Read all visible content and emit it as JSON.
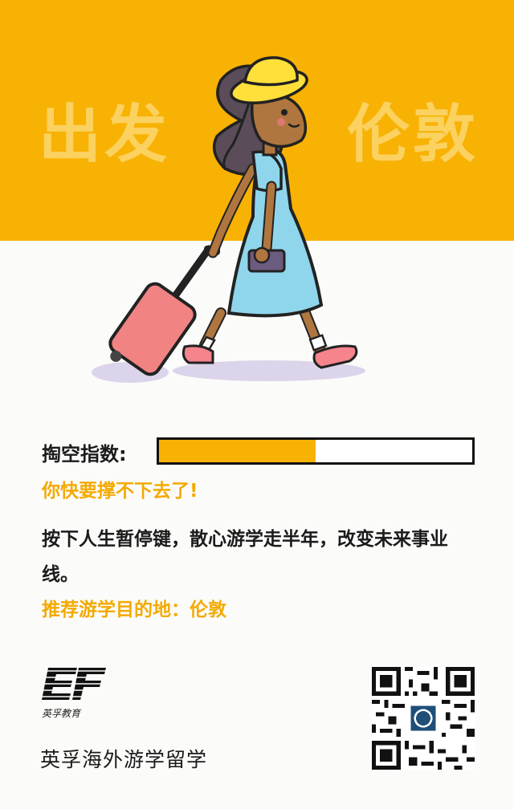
{
  "colors": {
    "accent": "#f8b204",
    "text": "#1b1b1b",
    "warning_text": "#f4aa02"
  },
  "header": {
    "word_left": "出发",
    "word_right": "伦敦"
  },
  "meter": {
    "label": "掏空指数:",
    "level_percent": 50
  },
  "warning": "你快要撑不下去了!",
  "body": "按下人生暂停键，散心游学走半年，改变未来事业线。",
  "destination": "推荐游学目的地：伦敦",
  "logo": {
    "sub": "英孚教育",
    "mark": "EF"
  },
  "footer": {
    "brand": "英孚海外游学留学"
  },
  "icons": {
    "qr": "qr-code-icon",
    "logo": "ef-logo-icon"
  }
}
